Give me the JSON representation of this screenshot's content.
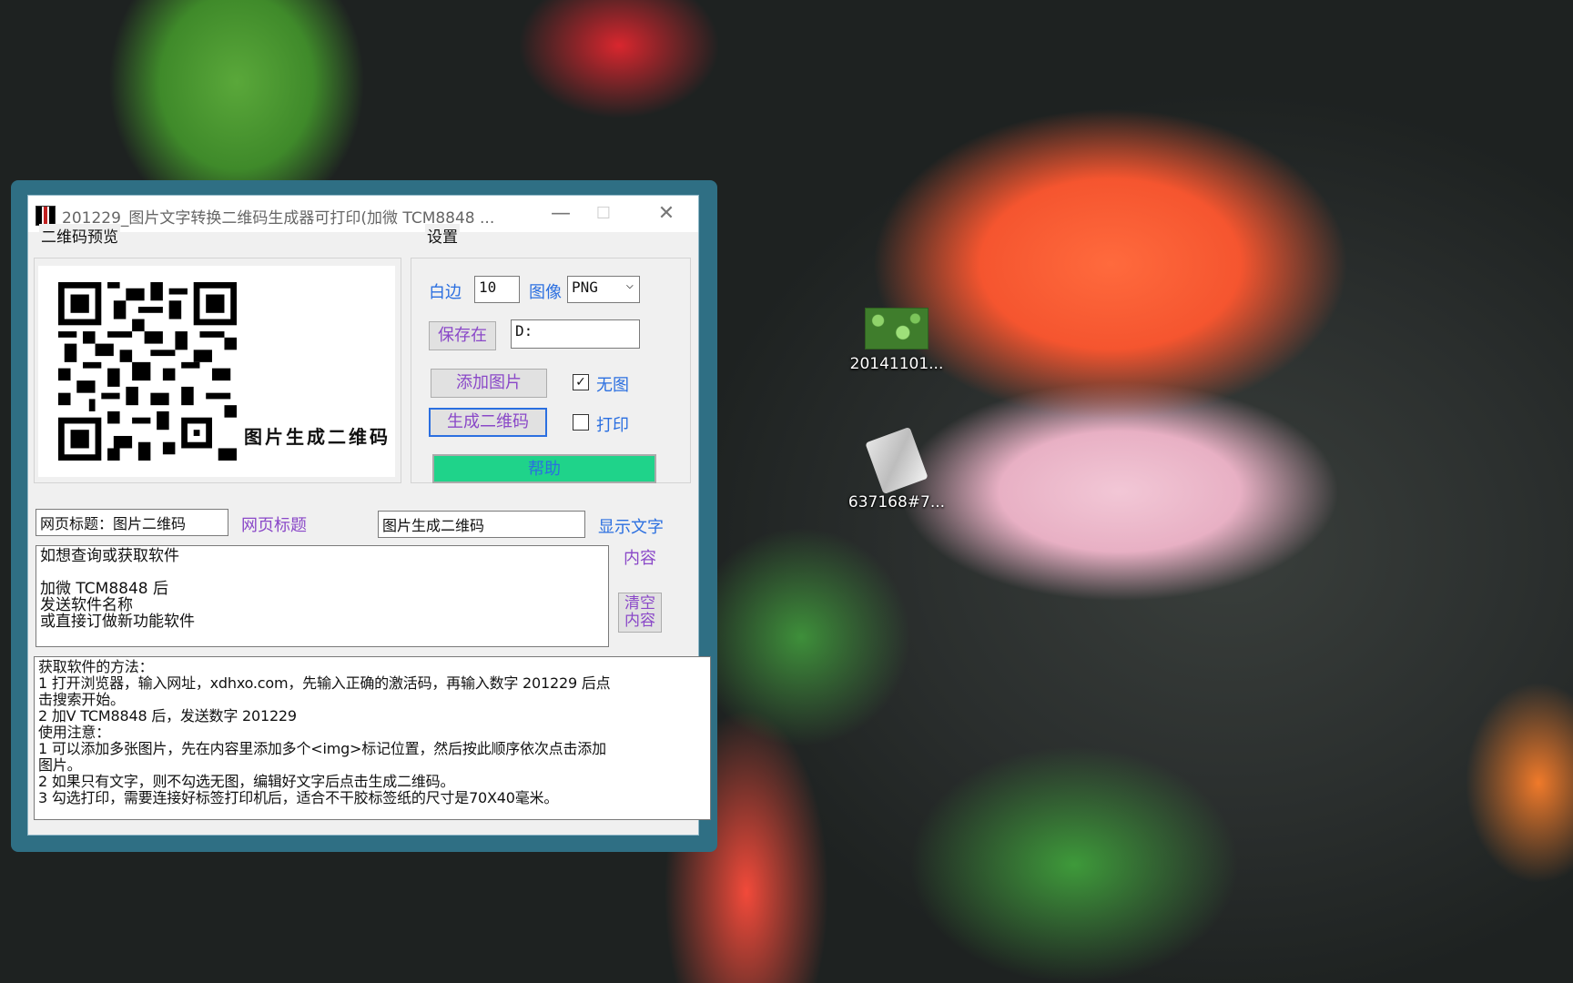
{
  "window": {
    "title": "201229_图片文字转换二维码生成器可打印(加微 TCM8848 ...",
    "minimize": "—",
    "maximize": "☐",
    "close": "✕"
  },
  "qr_group": {
    "title": "二维码预览",
    "caption": "图片生成二维码"
  },
  "settings": {
    "title": "设置",
    "margin_label": "白边",
    "margin_value": "10",
    "image_label": "图像",
    "image_format": "PNG",
    "save_button": "保存在",
    "save_path": "D:",
    "add_image_button": "添加图片",
    "no_image_label": "无图",
    "no_image_checked": true,
    "generate_button": "生成二维码",
    "print_label": "打印",
    "print_checked": false,
    "help_button": "帮助",
    "help_color": "#1fd38a"
  },
  "page_title": {
    "value": "网页标题：图片二维码",
    "label": "网页标题"
  },
  "display_text": {
    "value": "图片生成二维码",
    "label": "显示文字"
  },
  "content": {
    "label": "内容",
    "lines": [
      "如想查询或获取软件",
      "",
      "加微 TCM8848 后",
      "发送软件名称",
      "或直接订做新功能软件"
    ],
    "clear_button_line1": "清空",
    "clear_button_line2": "内容"
  },
  "help_text": {
    "lines": [
      "获取软件的方法：",
      "1 打开浏览器，输入网址，xdhxo.com，先输入正确的激活码，再输入数字 201229 后点",
      "击搜索开始。",
      "2 加V TCM8848 后，发送数字 201229",
      "使用注意：",
      "1 可以添加多张图片，先在内容里添加多个<img>标记位置，然后按此顺序依次点击添加",
      "图片。",
      "2 如果只有文字，则不勾选无图，编辑好文字后点击生成二维码。",
      "3 勾选打印，需要连接好标签打印机后，适合不干胶标签纸的尺寸是70X40毫米。"
    ]
  },
  "desktop": {
    "icon1_label": "20141101...",
    "icon2_label": "637168#7..."
  },
  "colors": {
    "frame": "#2f6f84",
    "blue_label": "#2b6fe0",
    "purple_label": "#8a48c8"
  }
}
